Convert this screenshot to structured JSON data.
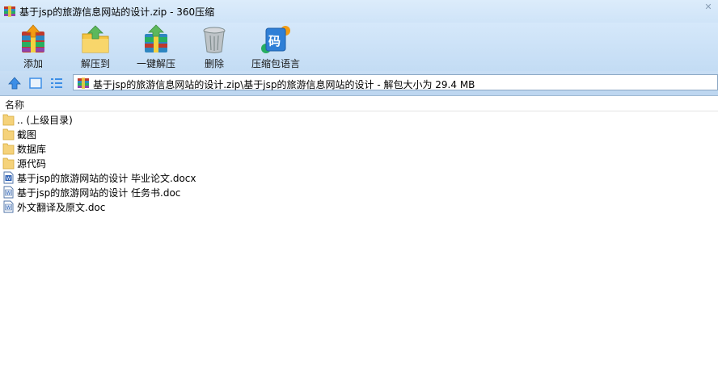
{
  "window": {
    "title": "基于jsp的旅游信息网站的设计.zip - 360压缩",
    "close_glyph": "✕"
  },
  "toolbar": {
    "items": [
      {
        "label": "添加",
        "icon": "add-books-icon"
      },
      {
        "label": "解压到",
        "icon": "extract-to-folder-icon"
      },
      {
        "label": "一键解压",
        "icon": "one-click-extract-icon"
      },
      {
        "label": "删除",
        "icon": "trash-can-icon"
      },
      {
        "label": "压缩包语言",
        "icon": "archive-language-icon",
        "glyph": "码"
      }
    ]
  },
  "navigation": {
    "address_path": "基于jsp的旅游信息网站的设计.zip\\基于jsp的旅游信息网站的设计 - 解包大小为 29.4 MB"
  },
  "file_list": {
    "column_name": "名称",
    "rows": [
      {
        "name": ".. (上级目录)",
        "type": "folder"
      },
      {
        "name": "截图",
        "type": "folder"
      },
      {
        "name": "数据库",
        "type": "folder"
      },
      {
        "name": "源代码",
        "type": "folder"
      },
      {
        "name": "基于jsp的旅游网站的设计 毕业论文.docx",
        "type": "docx"
      },
      {
        "name": "基于jsp的旅游网站的设计 任务书.doc",
        "type": "doc"
      },
      {
        "name": "外文翻译及原文.doc",
        "type": "doc"
      }
    ]
  },
  "colors": {
    "title_bar": "#dcecfb",
    "toolbar_bg": "#c3dcf4",
    "folder": "#f5d27a",
    "accent_blue": "#2f7fd6"
  }
}
